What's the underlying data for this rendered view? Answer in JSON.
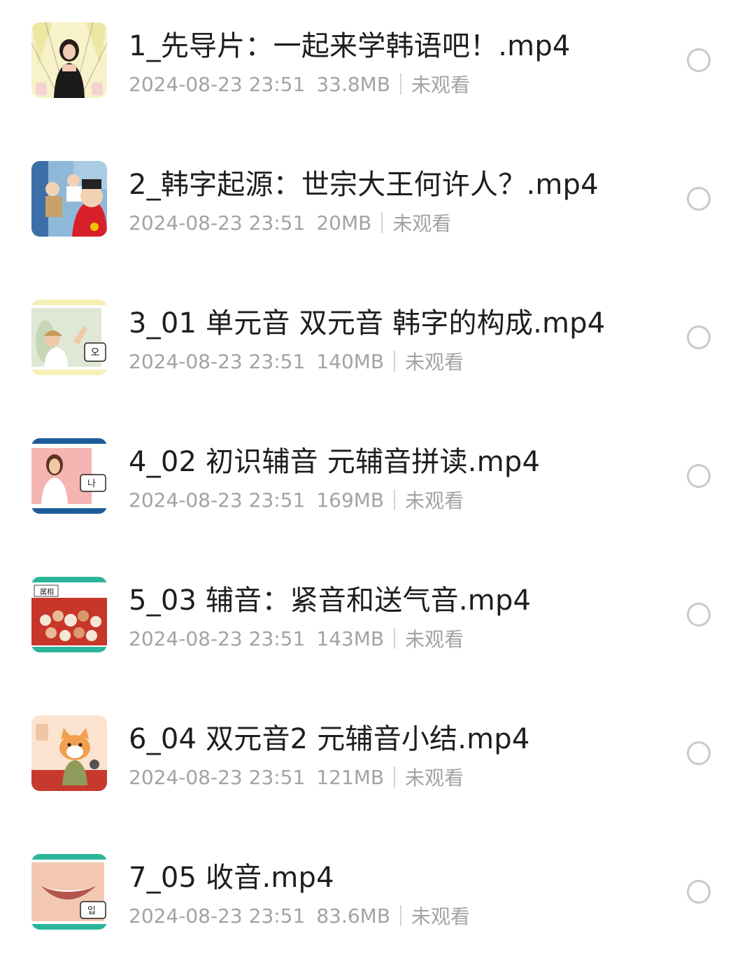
{
  "files": [
    {
      "title": "1_先导片：一起来学韩语吧！.mp4",
      "date": "2024-08-23 23:51",
      "size": "33.8MB",
      "status": "未观看",
      "thumb": "teacher-thumbnail"
    },
    {
      "title": "2_韩字起源：世宗大王何许人？.mp4",
      "date": "2024-08-23 23:51",
      "size": "20MB",
      "status": "未观看",
      "thumb": "king-cartoon-thumbnail"
    },
    {
      "title": "3_01 单元音 双元音 韩字的构成.mp4",
      "date": "2024-08-23 23:51",
      "size": "140MB",
      "status": "未观看",
      "thumb": "girl-waving-thumbnail"
    },
    {
      "title": "4_02 初识辅音 元辅音拼读.mp4",
      "date": "2024-08-23 23:51",
      "size": "169MB",
      "status": "未观看",
      "thumb": "presenter-thumbnail"
    },
    {
      "title": "5_03 辅音：紧音和送气音.mp4",
      "date": "2024-08-23 23:51",
      "size": "143MB",
      "status": "未观看",
      "thumb": "zodiac-figurines-thumbnail"
    },
    {
      "title": "6_04 双元音2 元辅音小结.mp4",
      "date": "2024-08-23 23:51",
      "size": "121MB",
      "status": "未观看",
      "thumb": "cat-cartoon-thumbnail"
    },
    {
      "title": "7_05 收音.mp4",
      "date": "2024-08-23 23:51",
      "size": "83.6MB",
      "status": "未观看",
      "thumb": "smile-thumbnail"
    }
  ],
  "thumb_labels": {
    "t3": "오",
    "t4": "나",
    "t5": "属相",
    "t7": "입"
  },
  "colors": {
    "title": "#1e1e1e",
    "meta": "#a3a3a3",
    "radio_border": "#c9c9c9",
    "separator": "#d4d4d4"
  }
}
